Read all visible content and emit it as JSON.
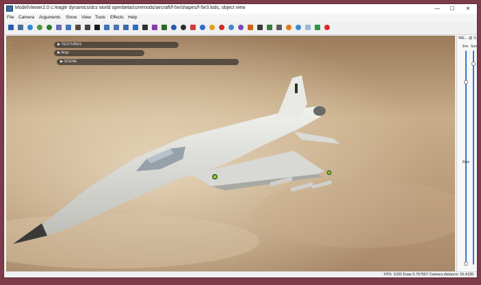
{
  "window": {
    "title": "ModelViewer2.0 c:/eagle dynamics/dcs world openbeta/coremods/aircraft/f-5e/shapes/f-5e3.lods, object view",
    "minimize": "—",
    "maximize": "☐",
    "close": "✕"
  },
  "menu": [
    "File",
    "Camera",
    "Arguments",
    "Show",
    "View",
    "Tools",
    "Effects",
    "Help"
  ],
  "toolbar": {
    "icons": [
      {
        "name": "save-icon",
        "color": "#2a5fb0"
      },
      {
        "name": "open-model-icon",
        "color": "#4d6e94"
      },
      {
        "name": "globe-icon",
        "color": "#2f86d6",
        "round": true
      },
      {
        "name": "refresh-icon",
        "color": "#4a9a3a",
        "round": true
      },
      {
        "name": "reload-icon",
        "color": "#2f7a2f",
        "round": true
      },
      {
        "name": "grid-view-icon",
        "color": "#6a6ab8"
      },
      {
        "name": "monitor-icon",
        "color": "#3d7ab8"
      },
      {
        "name": "person-icon",
        "color": "#5a4a3a"
      },
      {
        "name": "plus-icon",
        "color": "#444444"
      },
      {
        "name": "texture-icon",
        "color": "#1a1a1a"
      },
      {
        "name": "light-icon",
        "color": "#3a76b8"
      },
      {
        "name": "flask-icon",
        "color": "#4a74b0"
      },
      {
        "name": "key-icon",
        "color": "#3a6ab0"
      },
      {
        "name": "arrow-icon",
        "color": "#2a6ec4"
      },
      {
        "name": "film-icon",
        "color": "#303030"
      },
      {
        "name": "stack-icon",
        "color": "#8a3aa8"
      },
      {
        "name": "display-icon",
        "color": "#2a6a2a"
      },
      {
        "name": "rotate-icon",
        "color": "#2a5aa8",
        "round": true
      },
      {
        "name": "dark-circle-icon",
        "color": "#2a2a2a",
        "round": true
      },
      {
        "name": "bar-chart-icon",
        "color": "#d03a3a"
      },
      {
        "name": "blue-dot-icon",
        "color": "#2a6ed0",
        "round": true
      },
      {
        "name": "sun-icon",
        "color": "#e0a020",
        "round": true
      },
      {
        "name": "red-ball-icon",
        "color": "#d02a2a",
        "round": true
      },
      {
        "name": "sphere-icon",
        "color": "#3a8ad0",
        "round": true
      },
      {
        "name": "purple-sphere-icon",
        "color": "#7a4ab8",
        "round": true
      },
      {
        "name": "chart-icon",
        "color": "#c8641a"
      },
      {
        "name": "plane-icon",
        "color": "#3a3a3a"
      },
      {
        "name": "pin-icon",
        "color": "#3a7a3a"
      },
      {
        "name": "tank-icon",
        "color": "#5a5a5a"
      },
      {
        "name": "orange-ball-icon",
        "color": "#e07a1a",
        "round": true
      },
      {
        "name": "search-icon",
        "color": "#3a8ad0",
        "round": true
      },
      {
        "name": "window-icon",
        "color": "#9ab8d8"
      },
      {
        "name": "grid-icon",
        "color": "#2a9a4a"
      },
      {
        "name": "no-entry-icon",
        "color": "#e02a2a",
        "round": true
      }
    ]
  },
  "viewport": {
    "panels": [
      {
        "label": "▶  TEXTURES"
      },
      {
        "label": "▶  Args"
      },
      {
        "label": "▶  SCENE"
      }
    ],
    "overlay_lines": [
      "—",
      "—",
      "—",
      "—",
      "—"
    ],
    "overlay_right": "—"
  },
  "dock": {
    "title": "WE... @ S",
    "env_label": "Env",
    "sun_label": "Sun",
    "rain_label": "Rain"
  },
  "status": "FPS: 1020  Draw 0.757567  Camera distance: 16.4195"
}
